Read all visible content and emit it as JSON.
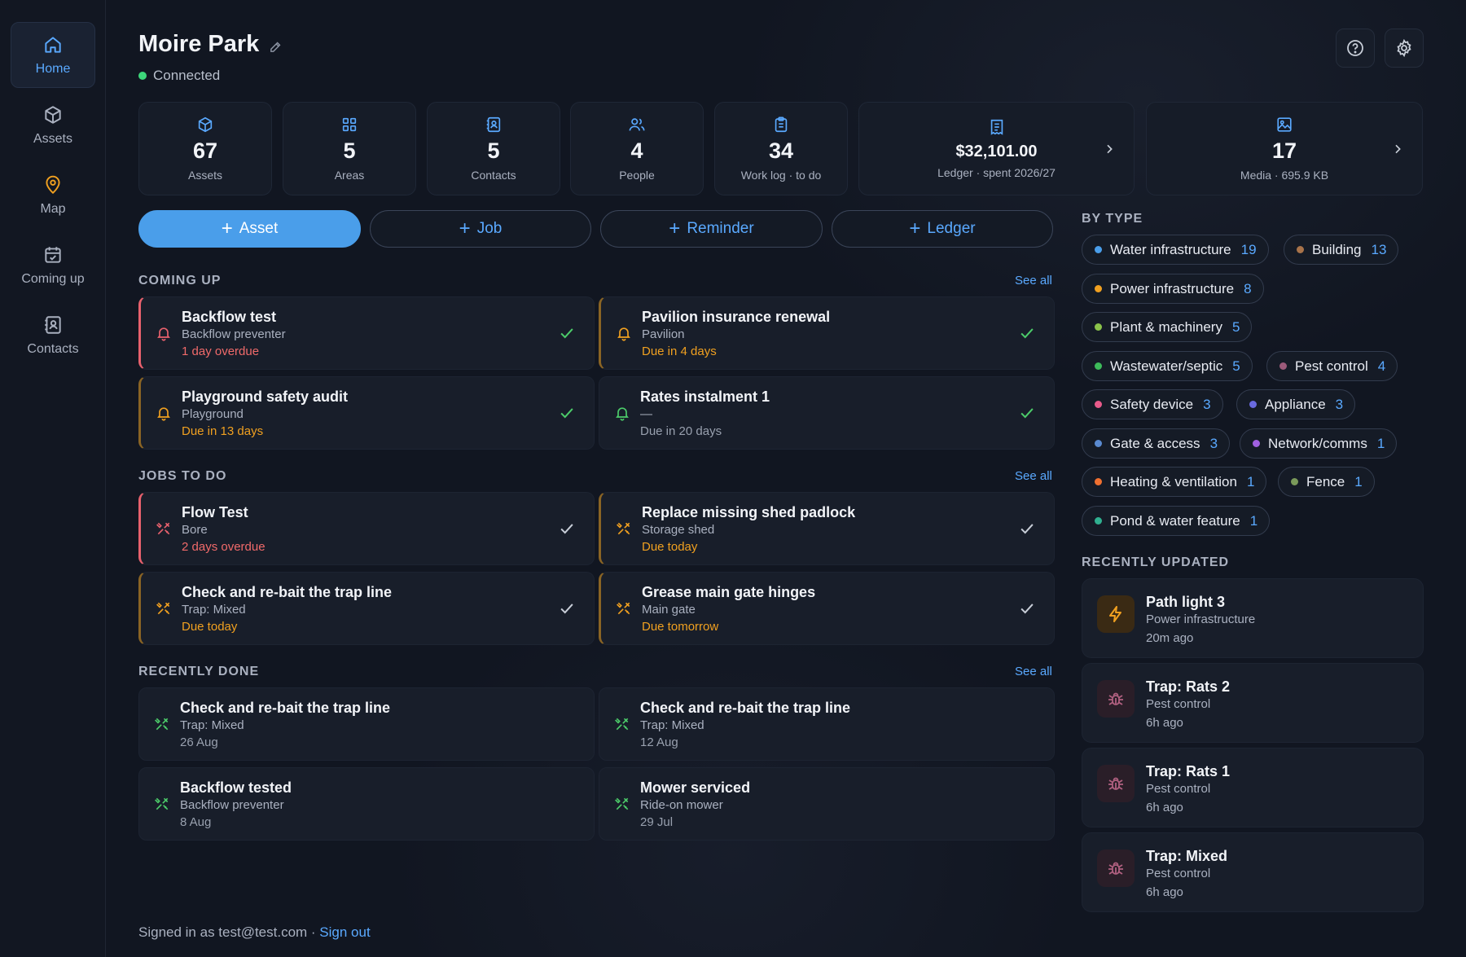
{
  "sidebar": {
    "items": [
      {
        "label": "Home",
        "icon": "home-icon"
      },
      {
        "label": "Assets",
        "icon": "box-icon"
      },
      {
        "label": "Map",
        "icon": "map-pin-icon"
      },
      {
        "label": "Coming up",
        "icon": "calendar-icon"
      },
      {
        "label": "Contacts",
        "icon": "contacts-icon"
      }
    ]
  },
  "header": {
    "title": "Moire Park",
    "status": "Connected"
  },
  "stats": [
    {
      "value": "67",
      "caption": "Assets",
      "icon": "box-icon"
    },
    {
      "value": "5",
      "caption": "Areas",
      "icon": "grid-icon"
    },
    {
      "value": "5",
      "caption": "Contacts",
      "icon": "contacts-icon"
    },
    {
      "value": "4",
      "caption": "People",
      "icon": "people-icon"
    },
    {
      "value": "34",
      "caption": "Work log · to do",
      "icon": "clipboard-icon"
    },
    {
      "value": "$32,101.00",
      "caption": "Ledger · spent 2026/27",
      "icon": "receipt-icon"
    },
    {
      "value": "17",
      "caption": "Media · 695.9 KB",
      "icon": "image-icon"
    }
  ],
  "actions": {
    "asset": "Asset",
    "job": "Job",
    "reminder": "Reminder",
    "ledger": "Ledger",
    "plus": "+"
  },
  "sections": {
    "coming_up": "COMING UP",
    "jobs": "JOBS TO DO",
    "done": "RECENTLY DONE",
    "by_type": "BY TYPE",
    "recent": "RECENTLY UPDATED",
    "see_all": "See all"
  },
  "coming_up": [
    {
      "title": "Backflow test",
      "sub": "Backflow preventer",
      "due": "1 day overdue"
    },
    {
      "title": "Pavilion insurance renewal",
      "sub": "Pavilion",
      "due": "Due in 4 days"
    },
    {
      "title": "Playground safety audit",
      "sub": "Playground",
      "due": "Due in 13 days"
    },
    {
      "title": "Rates instalment 1",
      "sub": "—",
      "due": "Due in 20 days"
    }
  ],
  "jobs": [
    {
      "title": "Flow Test",
      "sub": "Bore",
      "due": "2 days overdue"
    },
    {
      "title": "Replace missing shed padlock",
      "sub": "Storage shed",
      "due": "Due today"
    },
    {
      "title": "Check and re-bait the trap line",
      "sub": "Trap: Mixed",
      "due": "Due today"
    },
    {
      "title": "Grease main gate hinges",
      "sub": "Main gate",
      "due": "Due tomorrow"
    }
  ],
  "done": [
    {
      "title": "Check and re-bait the trap line",
      "sub": "Trap: Mixed",
      "date": "26 Aug"
    },
    {
      "title": "Check and re-bait the trap line",
      "sub": "Trap: Mixed",
      "date": "12 Aug"
    },
    {
      "title": "Backflow tested",
      "sub": "Backflow preventer",
      "date": "8 Aug"
    },
    {
      "title": "Mower serviced",
      "sub": "Ride-on mower",
      "date": "29 Jul"
    }
  ],
  "by_type": [
    {
      "label": "Water infrastructure",
      "count": "19",
      "color": "#4a9eea"
    },
    {
      "label": "Building",
      "count": "13",
      "color": "#a8734a"
    },
    {
      "label": "Power infrastructure",
      "count": "8",
      "color": "#f0a020"
    },
    {
      "label": "Plant & machinery",
      "count": "5",
      "color": "#8bc34a"
    },
    {
      "label": "Wastewater/septic",
      "count": "5",
      "color": "#3dbb5a"
    },
    {
      "label": "Pest control",
      "count": "4",
      "color": "#9c5a7a"
    },
    {
      "label": "Safety device",
      "count": "3",
      "color": "#e85a8a"
    },
    {
      "label": "Appliance",
      "count": "3",
      "color": "#6a6ae0"
    },
    {
      "label": "Gate & access",
      "count": "3",
      "color": "#5a8ad0"
    },
    {
      "label": "Network/comms",
      "count": "1",
      "color": "#a060e0"
    },
    {
      "label": "Heating & ventilation",
      "count": "1",
      "color": "#f07030"
    },
    {
      "label": "Fence",
      "count": "1",
      "color": "#7a9a5a"
    },
    {
      "label": "Pond & water feature",
      "count": "1",
      "color": "#30b090"
    }
  ],
  "recent": [
    {
      "title": "Path light 3",
      "sub": "Power infrastructure",
      "time": "20m ago",
      "icon": "bolt-icon"
    },
    {
      "title": "Trap: Rats 2",
      "sub": "Pest control",
      "time": "6h ago",
      "icon": "bug-icon"
    },
    {
      "title": "Trap: Rats 1",
      "sub": "Pest control",
      "time": "6h ago",
      "icon": "bug-icon"
    },
    {
      "title": "Trap: Mixed",
      "sub": "Pest control",
      "time": "6h ago",
      "icon": "bug-icon"
    }
  ],
  "footer": {
    "signed_in": "Signed in as test@test.com · ",
    "sign_out": "Sign out"
  }
}
